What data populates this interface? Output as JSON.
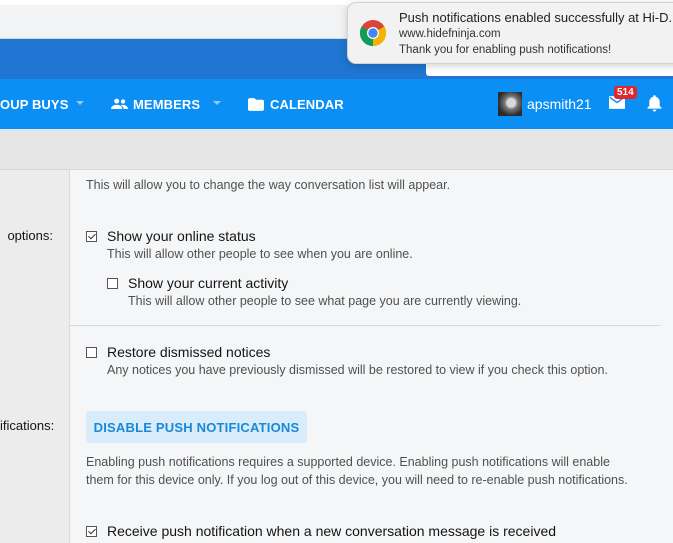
{
  "notification": {
    "title": "Push notifications enabled successfully at Hi-D.",
    "site": "www.hidefninja.com",
    "message": "Thank you for enabling push notifications!",
    "icon": "chrome-icon"
  },
  "nav": {
    "group_buys": "OUP BUYS",
    "members": "MEMBERS",
    "calendar": "CALENDAR",
    "username": "apsmith21",
    "inbox_count": "514"
  },
  "settings": {
    "list_hint": "This will allow you to change the way conversation list will appear.",
    "options_label": "options:",
    "online_status": {
      "label": "Show your online status",
      "checked": true,
      "hint": "This will allow other people to see when you are online."
    },
    "current_activity": {
      "label": "Show your current activity",
      "checked": false,
      "hint": "This will allow other people to see what page you are currently viewing."
    },
    "restore_notices": {
      "label": "Restore dismissed notices",
      "checked": false,
      "hint": "Any notices you have previously dismissed will be restored to view if you check this option."
    },
    "notifications_label": "ifications:",
    "push_button": "DISABLE PUSH NOTIFICATIONS",
    "push_para_1": "Enabling push notifications requires a supported device. Enabling push notifications will enable",
    "push_para_2": "them for this device only. If you log out of this device, you will need to re-enable push notifications.",
    "receive_push": {
      "label": "Receive push notification when a new conversation message is received",
      "checked": true
    }
  },
  "colors": {
    "nav_bg": "#0b8ff5",
    "header_bg": "#1f76d2",
    "button_bg": "#d9ecfb",
    "button_text": "#1a88d9",
    "badge": "#e3262b"
  }
}
